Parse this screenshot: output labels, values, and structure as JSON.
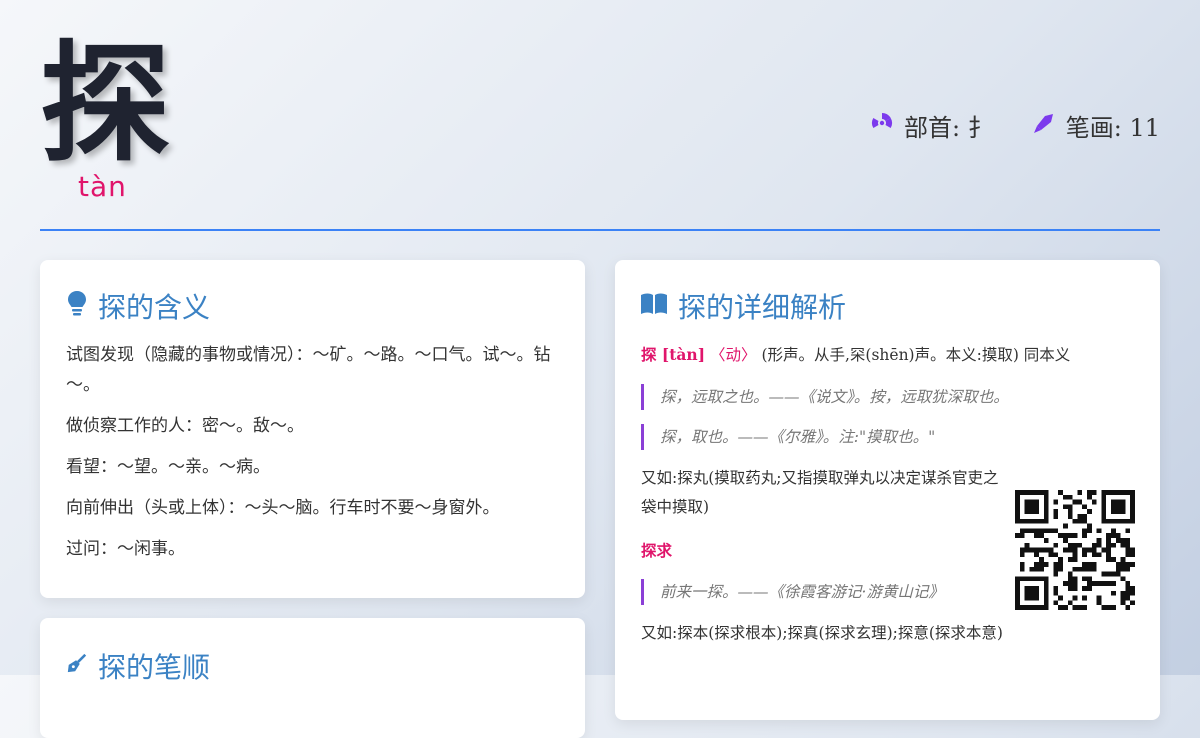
{
  "character": "探",
  "pinyin": "tàn",
  "radical_label": "部首: 扌",
  "strokes_label": "笔画: 11",
  "meaning": {
    "title": "探的含义",
    "items": [
      "试图发现（隐藏的事物或情况）：～矿。～路。～口气。试～。钻～。",
      "做侦察工作的人：密～。敌～。",
      "看望：～望。～亲。～病。",
      "向前伸出（头或上体）：～头～脑。行车时不要～身窗外。",
      "过问：～闲事。"
    ]
  },
  "stroke_order": {
    "title": "探的笔顺"
  },
  "detail": {
    "title": "探的详细解析",
    "head_word": "探 [tàn]",
    "head_pos": "〈动〉",
    "head_text": "(形声。从手,罙(shēn)声。本义:摸取) 同本义",
    "quote1": "探，远取之也。——《说文》。按，远取犹深取也。",
    "quote2": "探，取也。——《尔雅》。注:\"摸取也。\"",
    "example1": "又如:探丸(摸取药丸;又指摸取弹丸以决定谋杀官吏之袋中摸取)",
    "sub_word": "探求",
    "quote3": "前来一探。——《徐霞客游记·游黄山记》",
    "example2": "又如:探本(探求根本);探真(探求玄理);探意(探求本意)"
  }
}
